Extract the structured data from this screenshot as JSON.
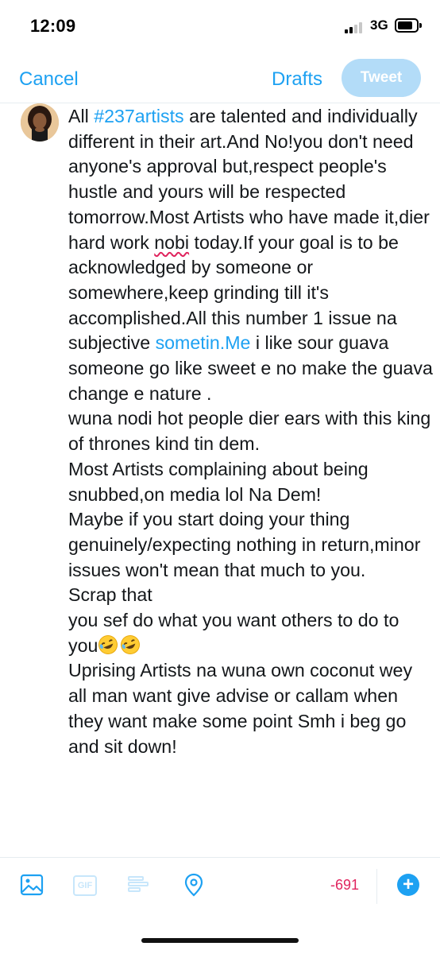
{
  "status_bar": {
    "time": "12:09",
    "network": "3G"
  },
  "header": {
    "cancel_label": "Cancel",
    "drafts_label": "Drafts",
    "tweet_label": "Tweet"
  },
  "compose": {
    "segments": [
      "All ",
      "#237artists",
      " are talented and individually different in their art.And No!you don't need anyone's approval but,respect people's hustle and yours will be respected tomorrow.Most Artists who have made it,dier hard work ",
      "nobi",
      " today.If your goal is to be acknowledged by someone or somewhere,keep grinding till it's accomplished.All this number 1 issue na subjective ",
      "sometin.Me",
      " i like sour guava someone go like sweet e no make the guava change e nature .\nwuna nodi hot people dier ears with this king of thrones kind tin dem.\nMost Artists complaining about being snubbed,on media lol Na Dem!\nMaybe if you start doing your thing genuinely/expecting nothing in return,minor issues won't mean that much to you.\nScrap that\nyou sef do what you want others to do to you",
      "\nUprising Artists na wuna own coconut wey all man want give advise or callam when they want make some point Smh i beg go and sit down!"
    ],
    "emoji": "rolling-on-floor-laughing"
  },
  "toolbar": {
    "gif_label": "GIF",
    "char_count": "-691"
  },
  "colors": {
    "accent": "#1da1f2",
    "disabled_button": "#b3dcf8",
    "counter_over": "#e0245e"
  }
}
